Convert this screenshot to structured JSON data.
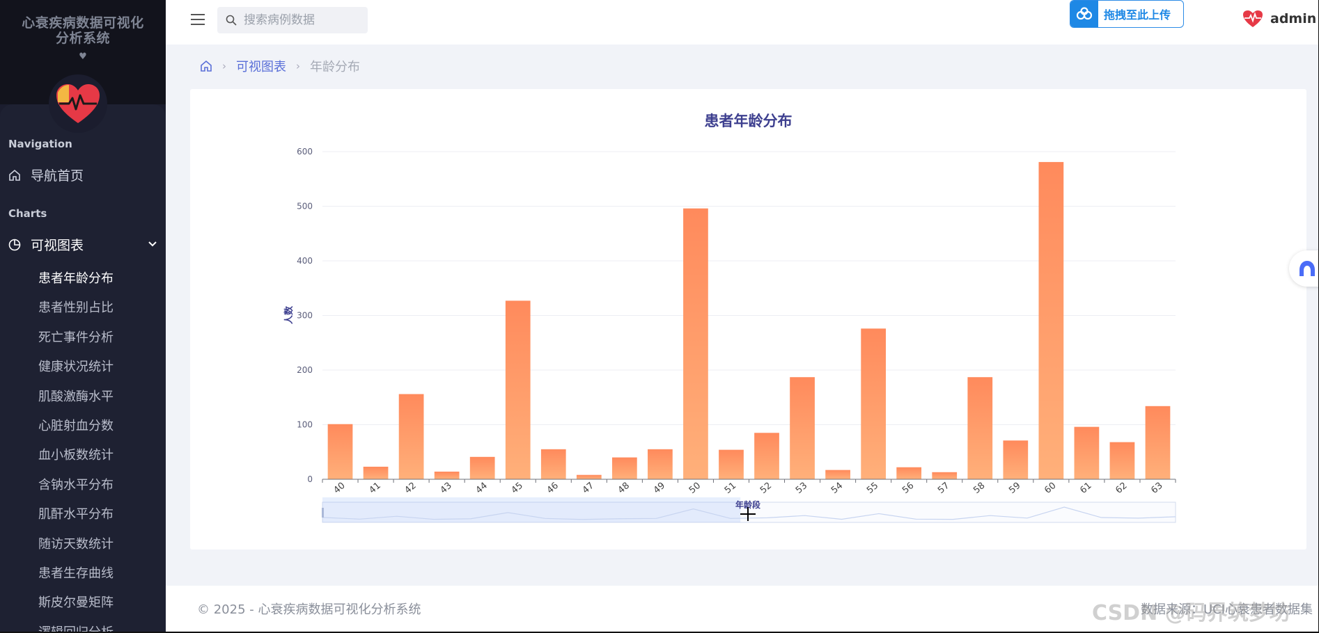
{
  "sidebar": {
    "app_title_line1": "心衰疾病数据可视化",
    "app_title_line2": "分析系统",
    "heart_glyph": "♥",
    "section_navigation": "Navigation",
    "home_label": "导航首页",
    "section_charts": "Charts",
    "charts_label": "可视图表",
    "sub_items": [
      "患者年龄分布",
      "患者性别占比",
      "死亡事件分析",
      "健康状况统计",
      "肌酸激酶水平",
      "心脏射血分数",
      "血小板数统计",
      "含钠水平分布",
      "肌酐水平分布",
      "随访天数统计",
      "患者生存曲线",
      "斯皮尔曼矩阵",
      "逻辑回归分析"
    ]
  },
  "topbar": {
    "search_placeholder": "搜索病例数据",
    "upload_label": "拖拽至此上传",
    "username": "admin"
  },
  "breadcrumb": {
    "level1": "可视图表",
    "level2": "年龄分布"
  },
  "footer": {
    "copyright": "© 2025 - 心衰疾病数据可视化分析系统",
    "right_text": "数据来源：UCI心衰患者数据集",
    "watermark": "CSDN @码界筑梦坊"
  },
  "colors": {
    "bar_top": "#ff8a5c",
    "bar_bottom": "#ffb07a",
    "title": "#3d3f8f",
    "sidebar_bg": "#1e2132",
    "accent": "#5a6fd8"
  },
  "chart_data": {
    "type": "bar",
    "title": "患者年龄分布",
    "xlabel": "年龄段",
    "ylabel": "人数",
    "ylim": [
      0,
      600
    ],
    "yticks": [
      0,
      100,
      200,
      300,
      400,
      500,
      600
    ],
    "grid": true,
    "categories": [
      "40",
      "41",
      "42",
      "43",
      "44",
      "45",
      "46",
      "47",
      "48",
      "49",
      "50",
      "51",
      "52",
      "53",
      "54",
      "55",
      "56",
      "57",
      "58",
      "59",
      "60",
      "61",
      "62",
      "63"
    ],
    "values": [
      101,
      23,
      156,
      14,
      41,
      327,
      55,
      8,
      40,
      55,
      496,
      54,
      85,
      187,
      17,
      276,
      22,
      13,
      187,
      71,
      581,
      96,
      68,
      134
    ],
    "data_zoom": true
  }
}
